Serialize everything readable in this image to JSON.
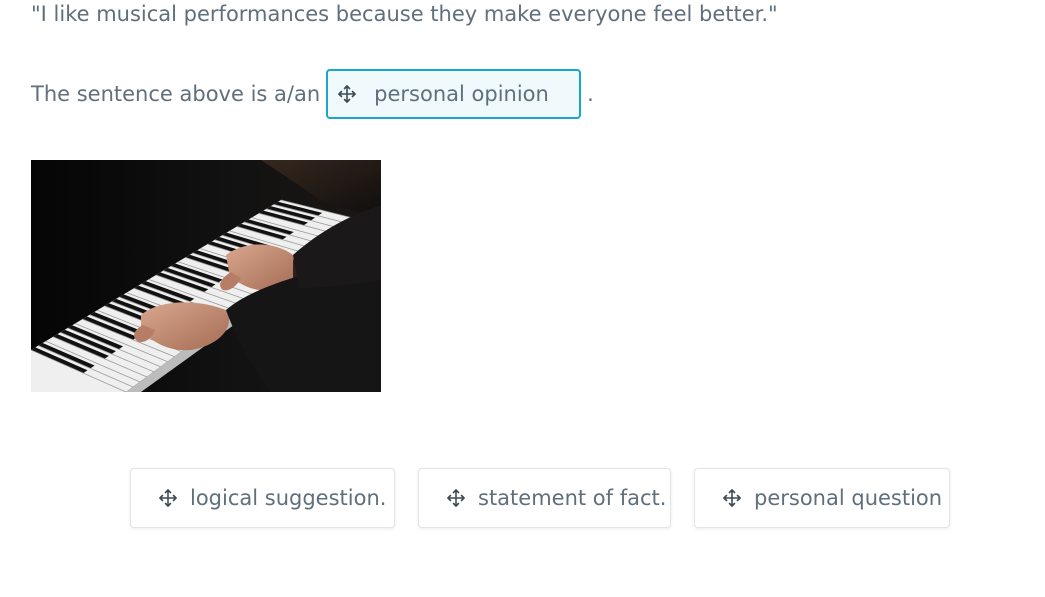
{
  "question": {
    "quote": "\"I like musical performances because they make everyone feel better.\"",
    "prompt": "The sentence above is a/an",
    "period": "."
  },
  "drop_zone": {
    "placed_answer": "personal opinion",
    "icon": "move-icon"
  },
  "choices": [
    {
      "label": "logical suggestion.",
      "icon": "move-icon"
    },
    {
      "label": "statement of fact.",
      "icon": "move-icon"
    },
    {
      "label": "personal question",
      "icon": "move-icon"
    }
  ],
  "colors": {
    "text": "#5f6f7b",
    "accent": "#1aa6c6",
    "drop_bg": "#f0fafd",
    "chip_border": "#dfe5e9"
  }
}
